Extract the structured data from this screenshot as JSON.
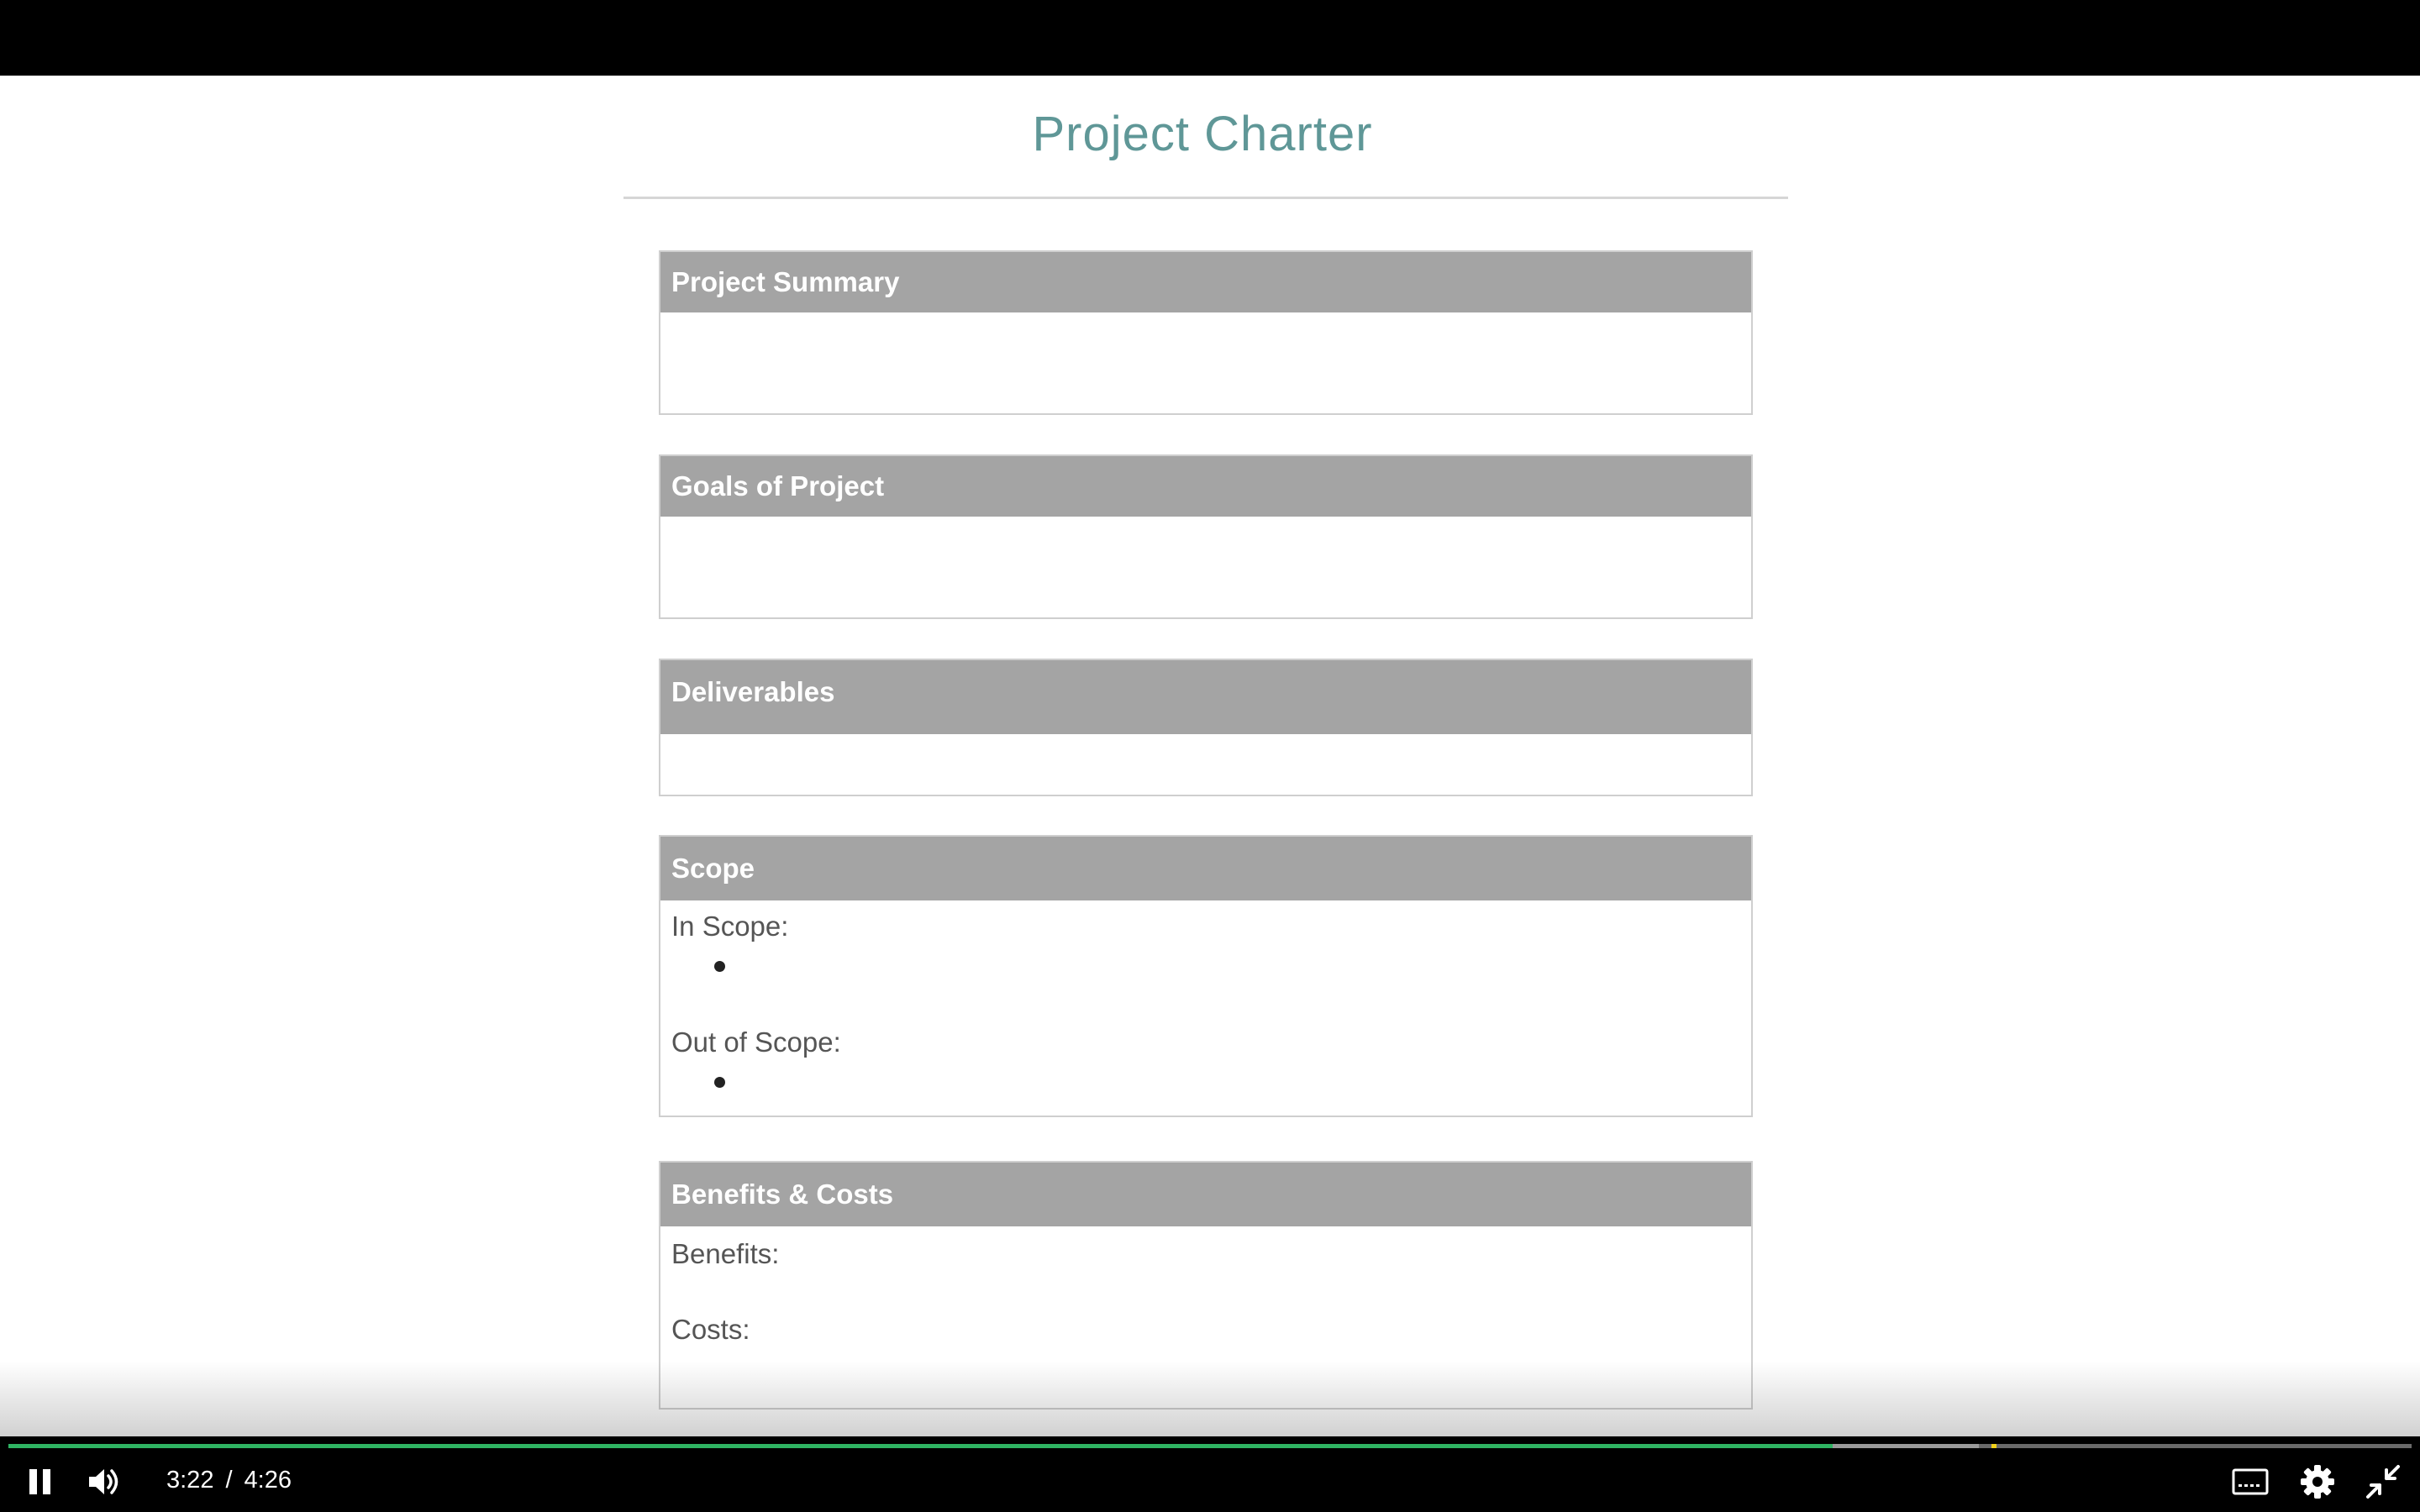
{
  "document": {
    "title": "Project Charter",
    "sections": [
      {
        "header": "Project Summary"
      },
      {
        "header": "Goals of Project"
      },
      {
        "header": "Deliverables"
      },
      {
        "header": "Scope",
        "in_scope_label": "In Scope:",
        "out_scope_label": "Out of Scope:"
      },
      {
        "header": "Benefits & Costs",
        "benefits_label": "Benefits:",
        "costs_label": "Costs:"
      }
    ]
  },
  "player": {
    "current_time": "3:22",
    "separator": "/",
    "duration": "4:26",
    "progress_fraction": 0.759,
    "buffered_fraction": 0.82,
    "marker_fraction": 0.825,
    "played_color": "#2fb463",
    "marker_color": "#f2d21b",
    "icons": [
      "pause-icon",
      "volume-icon",
      "captions-icon",
      "settings-gear-icon",
      "exit-fullscreen-icon"
    ]
  }
}
